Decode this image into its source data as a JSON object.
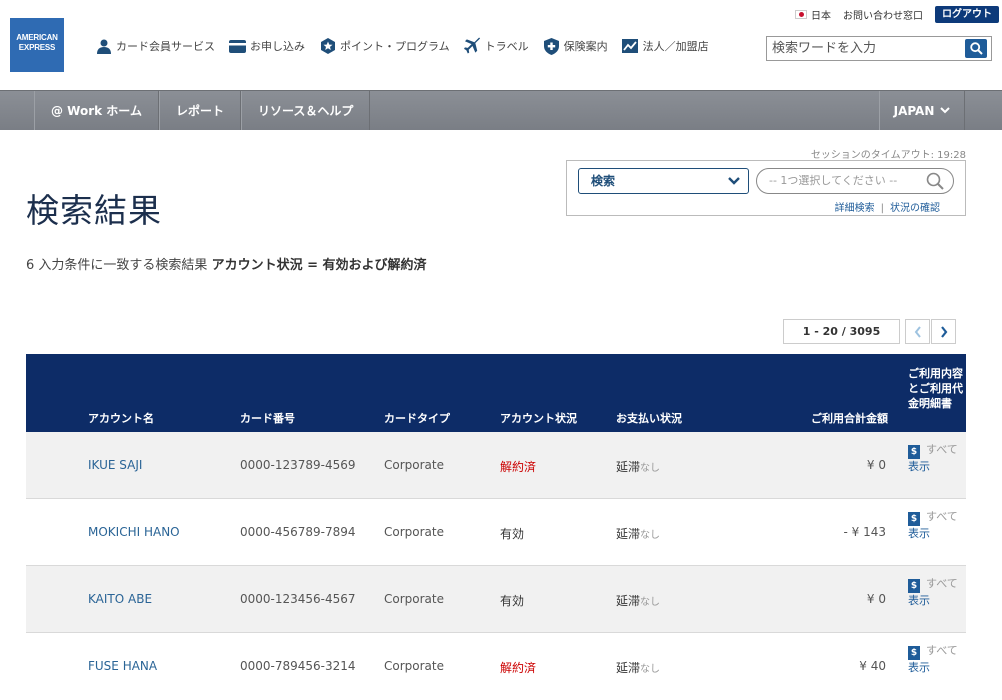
{
  "brand": {
    "line1": "AMERICAN",
    "line2": "EXPRESS"
  },
  "util": {
    "country": "日本",
    "contact": "お問い合わせ窓口",
    "logout": "ログアウト"
  },
  "top_nav": [
    {
      "label": "カード会員サービス",
      "icon": "person-icon"
    },
    {
      "label": "お申し込み",
      "icon": "card-icon"
    },
    {
      "label": "ポイント・プログラム",
      "icon": "star-badge-icon"
    },
    {
      "label": "トラベル",
      "icon": "airplane-icon"
    },
    {
      "label": "保険案内",
      "icon": "shield-plus-icon"
    },
    {
      "label": "法人／加盟店",
      "icon": "chart-icon"
    }
  ],
  "search_top": {
    "placeholder": "検索ワードを入力"
  },
  "main_nav": {
    "tabs": [
      "@ Work ホーム",
      "レポート",
      "リソース＆ヘルプ"
    ],
    "country": "JAPAN"
  },
  "session": {
    "label": "セッションのタイムアウト:",
    "time": "19:28"
  },
  "search_box": {
    "select_value": "検索",
    "criteria_placeholder": "-- 1つ選択してください --",
    "advanced": "詳細検索",
    "status_check": "状況の確認"
  },
  "page": {
    "title": "検索結果",
    "summary_count": "6",
    "summary_text": "入力条件に一致する検索結果",
    "summary_condition": "アカウント状況 = 有効および解約済"
  },
  "pager": {
    "range": "1 - 20 / 3095"
  },
  "table": {
    "headers": [
      "アカウント名",
      "カード番号",
      "カードタイプ",
      "アカウント状況",
      "お支払い状況",
      "ご利用合計金額",
      "ご利用内容とご利用代金明細書"
    ],
    "rows": [
      {
        "name": "IKUE SAJI",
        "number": "0000-123789-4569",
        "type": "Corporate",
        "status": "解約済",
        "closed": true,
        "pay": "延滞",
        "pay_sub": "なし",
        "amount": "¥ 0",
        "view_a": "すべて",
        "view_b": "表示"
      },
      {
        "name": "MOKICHI HANO",
        "number": "0000-456789-7894",
        "type": "Corporate",
        "status": "有効",
        "closed": false,
        "pay": "延滞",
        "pay_sub": "なし",
        "amount": "- ¥ 143",
        "view_a": "すべて",
        "view_b": "表示"
      },
      {
        "name": "KAITO ABE",
        "number": "0000-123456-4567",
        "type": "Corporate",
        "status": "有効",
        "closed": false,
        "pay": "延滞",
        "pay_sub": "なし",
        "amount": "¥ 0",
        "view_a": "すべて",
        "view_b": "表示"
      },
      {
        "name": "FUSE HANA",
        "number": "0000-789456-3214",
        "type": "Corporate",
        "status": "解約済",
        "closed": true,
        "pay": "延滞",
        "pay_sub": "なし",
        "amount": "¥ 40",
        "view_a": "すべて",
        "view_b": "表示"
      }
    ]
  },
  "colors": {
    "brand_blue": "#2f6bb3",
    "table_header": "#0d2c67",
    "nav_grey": "#7a7e85",
    "link": "#2a6496",
    "closed_red": "#cc0000"
  }
}
